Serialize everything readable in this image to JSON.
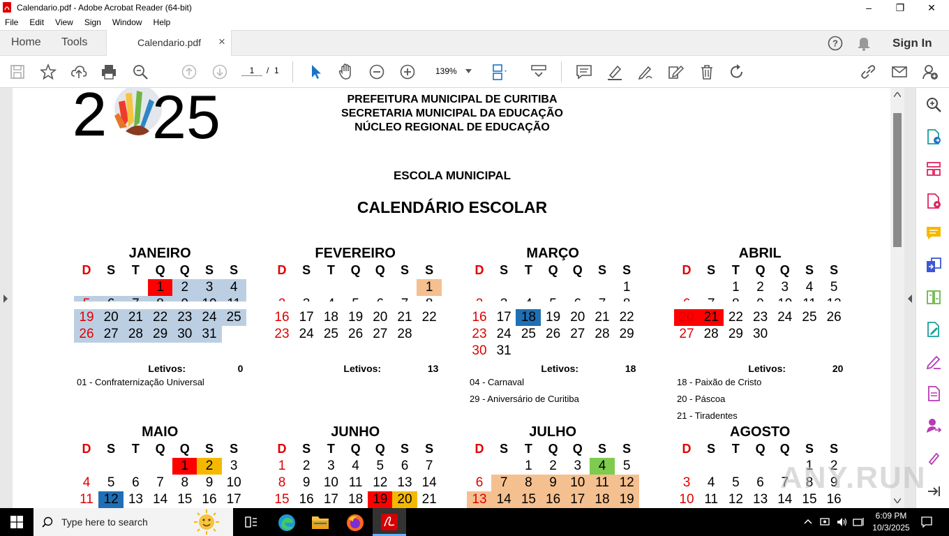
{
  "window": {
    "title": "Calendario.pdf - Adobe Acrobat Reader (64-bit)",
    "minimize": "–",
    "maximize": "❐",
    "close": "✕"
  },
  "menu": [
    "File",
    "Edit",
    "View",
    "Sign",
    "Window",
    "Help"
  ],
  "tabs": {
    "home": "Home",
    "tools": "Tools",
    "doc": "Calendario.pdf",
    "doc_close": "×",
    "sign_in": "Sign In"
  },
  "toolbar": {
    "page_current": "1",
    "page_sep": "/",
    "page_total": "1",
    "zoom": "139%"
  },
  "doc": {
    "logo_year": "2025",
    "header_lines": [
      "PREFEITURA MUNICIPAL DE CURITIBA",
      "SECRETARIA MUNICIPAL DA EDUCAÇÃO",
      "NÚCLEO REGIONAL DE EDUCAÇÃO"
    ],
    "school": "ESCOLA MUNICIPAL",
    "title": "CALENDÁRIO ESCOLAR",
    "weekdays": [
      "D",
      "S",
      "T",
      "Q",
      "Q",
      "S",
      "S"
    ],
    "letivos_label": "Letivos:",
    "months": [
      {
        "name": "JANEIRO",
        "letivos": "0",
        "notes": [
          "01 - Confraternização Universal"
        ],
        "rows": [
          [
            "",
            "",
            "",
            "1",
            "2",
            "3",
            "4"
          ],
          [
            "5",
            "6",
            "7",
            "8",
            "9",
            "10",
            "11"
          ],
          [
            "19",
            "20",
            "21",
            "22",
            "23",
            "24",
            "25"
          ],
          [
            "26",
            "27",
            "28",
            "29",
            "30",
            "31",
            ""
          ]
        ],
        "highlight": [
          "#ff0000",
          "",
          "",
          "",
          "",
          ""
        ]
      },
      {
        "name": "FEVEREIRO",
        "letivos": "13",
        "notes": [],
        "rows": [
          [
            "",
            "",
            "",
            "",
            "",
            "",
            "1"
          ],
          [
            "2",
            "3",
            "4",
            "5",
            "6",
            "7",
            "8"
          ],
          [
            "16",
            "17",
            "18",
            "19",
            "20",
            "21",
            "22"
          ],
          [
            "23",
            "24",
            "25",
            "26",
            "27",
            "28",
            ""
          ]
        ]
      },
      {
        "name": "MARÇO",
        "letivos": "18",
        "notes": [
          "04 - Carnaval",
          "29 - Aniversário de Curitiba"
        ],
        "rows": [
          [
            "",
            "",
            "",
            "",
            "",
            "",
            "1"
          ],
          [
            "2",
            "3",
            "4",
            "5",
            "6",
            "7",
            "8"
          ],
          [
            "16",
            "17",
            "18",
            "19",
            "20",
            "21",
            "22"
          ],
          [
            "23",
            "24",
            "25",
            "26",
            "27",
            "28",
            "29"
          ],
          [
            "30",
            "31",
            "",
            "",
            "",
            "",
            ""
          ]
        ]
      },
      {
        "name": "ABRIL",
        "letivos": "20",
        "notes": [
          "18 - Paixão de Cristo",
          "20 - Páscoa",
          "21 - Tiradentes"
        ],
        "rows": [
          [
            "",
            "",
            "1",
            "2",
            "3",
            "4",
            "5"
          ],
          [
            "6",
            "7",
            "8",
            "9",
            "10",
            "11",
            "12"
          ],
          [
            "20",
            "21",
            "22",
            "23",
            "24",
            "25",
            "26"
          ],
          [
            "27",
            "28",
            "29",
            "30",
            "",
            "",
            ""
          ]
        ]
      },
      {
        "name": "MAIO",
        "rows": [
          [
            "",
            "",
            "",
            "",
            "1",
            "2",
            "3"
          ],
          [
            "4",
            "5",
            "6",
            "7",
            "8",
            "9",
            "10"
          ],
          [
            "11",
            "12",
            "13",
            "14",
            "15",
            "16",
            "17"
          ]
        ]
      },
      {
        "name": "JUNHO",
        "rows": [
          [
            "1",
            "2",
            "3",
            "4",
            "5",
            "6",
            "7"
          ],
          [
            "8",
            "9",
            "10",
            "11",
            "12",
            "13",
            "14"
          ],
          [
            "15",
            "16",
            "17",
            "18",
            "19",
            "20",
            "21"
          ]
        ]
      },
      {
        "name": "JULHO",
        "rows": [
          [
            "",
            "",
            "1",
            "2",
            "3",
            "4",
            "5"
          ],
          [
            "6",
            "7",
            "8",
            "9",
            "10",
            "11",
            "12"
          ],
          [
            "13",
            "14",
            "15",
            "16",
            "17",
            "18",
            "19"
          ]
        ]
      },
      {
        "name": "AGOSTO",
        "rows": [
          [
            "",
            "",
            "",
            "",
            "",
            "1",
            "2"
          ],
          [
            "3",
            "4",
            "5",
            "6",
            "7",
            "8",
            "9"
          ],
          [
            "10",
            "11",
            "12",
            "13",
            "14",
            "15",
            "16"
          ]
        ]
      }
    ]
  },
  "taskbar": {
    "search_placeholder": "Type here to search",
    "time": "6:09 PM",
    "date": "10/3/2025"
  },
  "watermark": "ANY.RUN"
}
